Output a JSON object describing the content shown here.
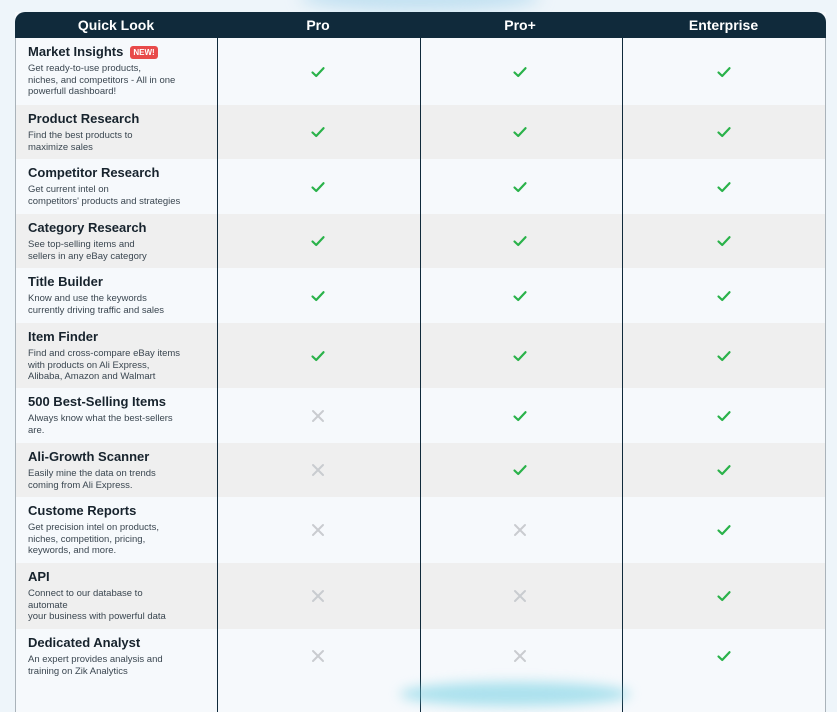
{
  "header": {
    "col0": "Quick Look",
    "col1": "Pro",
    "col2": "Pro+",
    "col3": "Enterprise"
  },
  "colors": {
    "header_bg": "#102a3b",
    "check": "#2ab24a",
    "cross": "#c9ccd0",
    "badge": "#e84a4a"
  },
  "rows": [
    {
      "name": "Market Insights",
      "badge": "NEW!",
      "desc": "Get ready-to-use products,\nniches, and competitors - All in one\npowerfull dashboard!",
      "pro": "check",
      "pro_plus": "check",
      "enterprise": "check"
    },
    {
      "name": "Product Research",
      "badge": "",
      "desc": "Find the best products to\nmaximize sales",
      "pro": "check",
      "pro_plus": "check",
      "enterprise": "check"
    },
    {
      "name": "Competitor Research",
      "badge": "",
      "desc": "Get current intel on\ncompetitors' products and strategies",
      "pro": "check",
      "pro_plus": "check",
      "enterprise": "check"
    },
    {
      "name": "Category Research",
      "badge": "",
      "desc": "See top-selling items and\nsellers in any eBay category",
      "pro": "check",
      "pro_plus": "check",
      "enterprise": "check"
    },
    {
      "name": "Title Builder",
      "badge": "",
      "desc": "Know and use the keywords\ncurrently driving traffic and sales",
      "pro": "check",
      "pro_plus": "check",
      "enterprise": "check"
    },
    {
      "name": "Item Finder",
      "badge": "",
      "desc": "Find and cross-compare eBay items\nwith products on Ali Express,\nAlibaba, Amazon and Walmart",
      "pro": "check",
      "pro_plus": "check",
      "enterprise": "check"
    },
    {
      "name": "500 Best-Selling Items",
      "badge": "",
      "desc": "Always know what the best-sellers\nare.",
      "pro": "cross",
      "pro_plus": "check",
      "enterprise": "check"
    },
    {
      "name": "Ali-Growth Scanner",
      "badge": "",
      "desc": "Easily mine the data on trends\ncoming from Ali Express.",
      "pro": "cross",
      "pro_plus": "check",
      "enterprise": "check"
    },
    {
      "name": "Custome Reports",
      "badge": "",
      "desc": "Get precision intel on products,\nniches, competition, pricing,\nkeywords, and more.",
      "pro": "cross",
      "pro_plus": "cross",
      "enterprise": "check"
    },
    {
      "name": "API",
      "badge": "",
      "desc": "Connect to our database to\nautomate\nyour business with powerful data",
      "pro": "cross",
      "pro_plus": "cross",
      "enterprise": "check"
    },
    {
      "name": "Dedicated Analyst",
      "badge": "",
      "desc": "An expert provides analysis and\ntraining on Zik Analytics",
      "pro": "cross",
      "pro_plus": "cross",
      "enterprise": "check"
    }
  ]
}
